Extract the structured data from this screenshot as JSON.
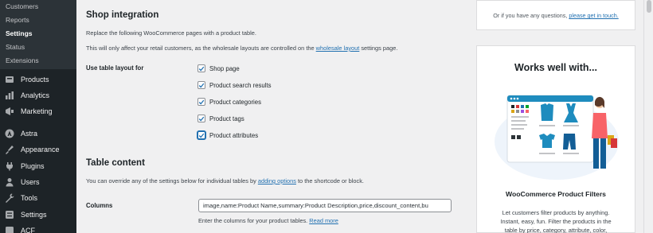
{
  "sidebar": {
    "submenu": [
      {
        "label": "Customers",
        "active": false
      },
      {
        "label": "Reports",
        "active": false
      },
      {
        "label": "Settings",
        "active": true
      },
      {
        "label": "Status",
        "active": false
      },
      {
        "label": "Extensions",
        "active": false
      }
    ],
    "menu": [
      {
        "label": "Products",
        "icon": "products-icon"
      },
      {
        "label": "Analytics",
        "icon": "analytics-icon"
      },
      {
        "label": "Marketing",
        "icon": "marketing-icon"
      },
      {
        "label": "Astra",
        "icon": "astra-icon"
      },
      {
        "label": "Appearance",
        "icon": "appearance-icon"
      },
      {
        "label": "Plugins",
        "icon": "plugins-icon"
      },
      {
        "label": "Users",
        "icon": "users-icon"
      },
      {
        "label": "Tools",
        "icon": "tools-icon"
      },
      {
        "label": "Settings",
        "icon": "settings-icon"
      },
      {
        "label": "ACF",
        "icon": "acf-icon"
      }
    ]
  },
  "shop_integration": {
    "heading": "Shop integration",
    "desc1": "Replace the following WooCommerce pages with a product table.",
    "desc2_before": "This will only affect your retail customers, as the wholesale layouts are controlled on the ",
    "desc2_link": "wholesale layout",
    "desc2_after": " settings page.",
    "layout_label": "Use table layout for",
    "options": [
      {
        "label": "Shop page",
        "checked": true
      },
      {
        "label": "Product search results",
        "checked": true
      },
      {
        "label": "Product categories",
        "checked": true
      },
      {
        "label": "Product tags",
        "checked": true
      },
      {
        "label": "Product attributes",
        "checked": true
      }
    ]
  },
  "table_content": {
    "heading": "Table content",
    "desc_before": "You can override any of the settings below for individual tables by ",
    "desc_link": "adding options",
    "desc_after": " to the shortcode or block.",
    "columns_label": "Columns",
    "columns_value": "image,name:Product Name,summary:Product Description,price,discount_content,bu",
    "columns_help_before": "Enter the columns for your product tables. ",
    "columns_help_link": "Read more"
  },
  "help_card": {
    "text_before": "Or if you have any questions, ",
    "link": "please get in touch."
  },
  "works_card": {
    "title": "Works well with...",
    "product_name": "WooCommerce Product Filters",
    "desc_lines": [
      "Let customers filter products by anything.",
      "Instant, easy, fun. Filter the products in the",
      "table by price, category, attribute, color,"
    ]
  },
  "colors": {
    "sidebar_bg": "#1d2327",
    "accent": "#2271b1"
  }
}
